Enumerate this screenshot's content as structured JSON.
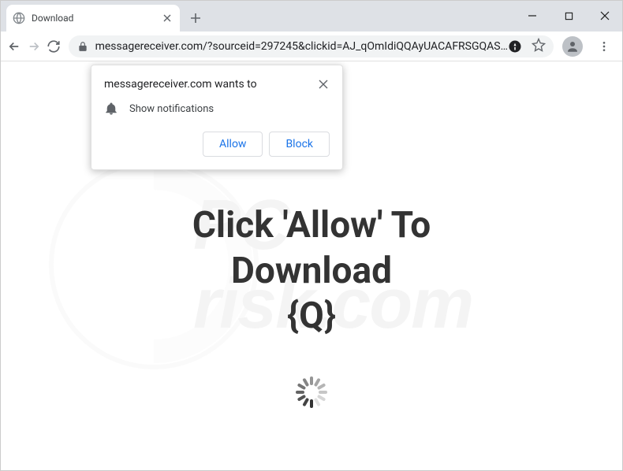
{
  "window": {
    "tab_title": "Download",
    "url": "messagereceiver.com/?sourceid=297245&clickid=AJ_qOmIdiQQAyUACAFRSGQAS…"
  },
  "permission_popup": {
    "title": "messagereceiver.com wants to",
    "description": "Show notifications",
    "allow_label": "Allow",
    "block_label": "Block"
  },
  "page": {
    "headline_line1": "Click 'Allow' To",
    "headline_line2": "Download",
    "headline_line3": "{Q}"
  },
  "watermark": {
    "line1": "PC",
    "line2": "risk.com"
  }
}
